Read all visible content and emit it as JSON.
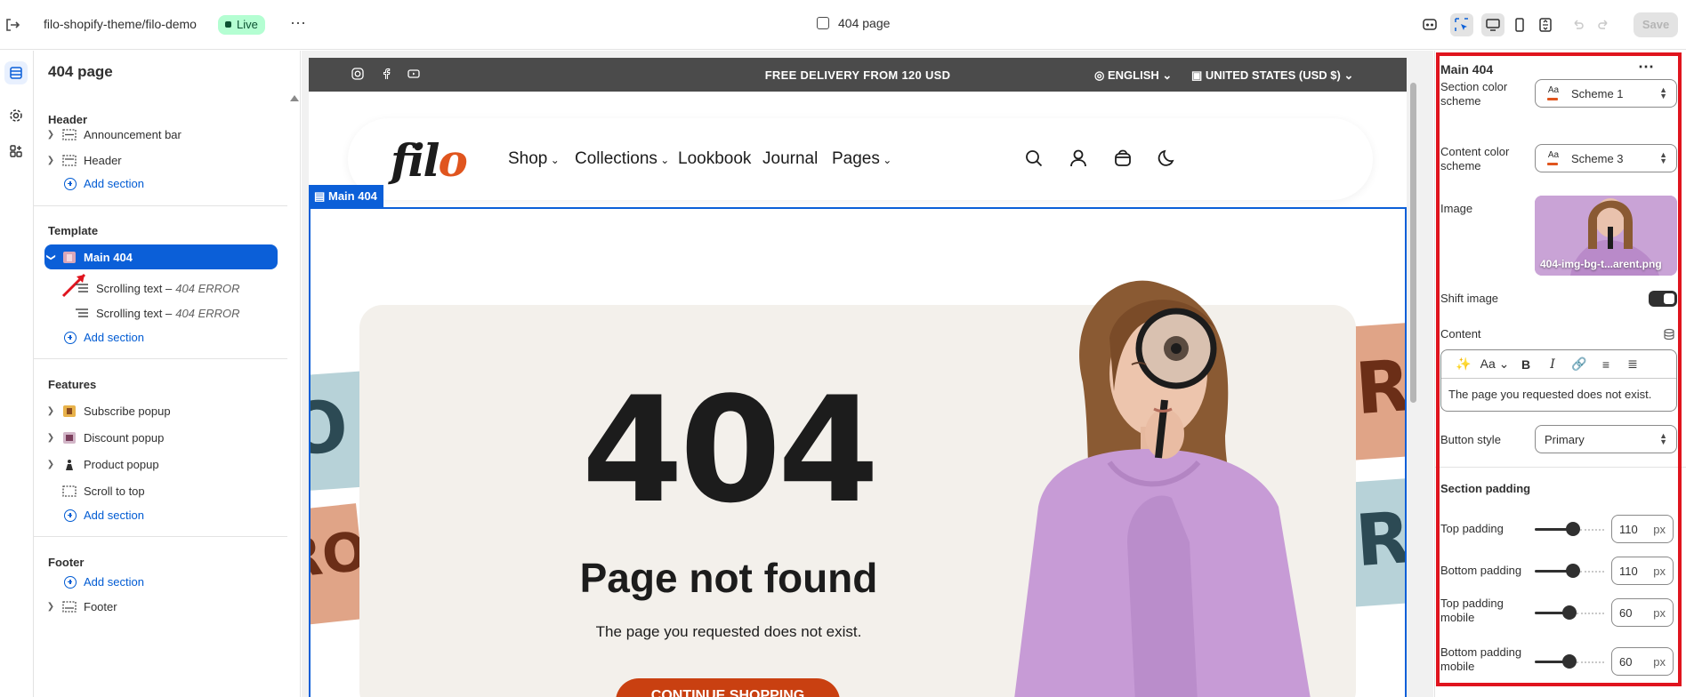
{
  "topbar": {
    "store_name": "filo-shopify-theme/filo-demo",
    "status": "Live",
    "more": "⋯",
    "page_title": "404 page",
    "save_label": "Save"
  },
  "sidebar": {
    "title": "404 page",
    "header_group": "Header",
    "header_items": [
      "Announcement bar",
      "Header"
    ],
    "template_group": "Template",
    "template_selected": "Main 404",
    "template_blocks": [
      {
        "label": "Scrolling text –",
        "sub": "404 ERROR"
      },
      {
        "label": "Scrolling text –",
        "sub": "404 ERROR"
      }
    ],
    "features_group": "Features",
    "features_items": [
      "Subscribe popup",
      "Discount popup",
      "Product popup",
      "Scroll to top"
    ],
    "footer_group": "Footer",
    "footer_items": [
      "Footer"
    ],
    "add_section": "Add section"
  },
  "preview": {
    "announcement": "FREE DELIVERY FROM 120 USD",
    "language": "ENGLISH",
    "currency": "UNITED STATES (USD $)",
    "logo_a": "fil",
    "logo_b": "o",
    "nav": [
      "Shop",
      "Collections",
      "Lookbook",
      "Journal",
      "Pages"
    ],
    "section_tag": "Main 404",
    "big": "404",
    "heading": "Page not found",
    "description": "The page you requested does not exist.",
    "cta": "CONTINUE SHOPPING",
    "banner_left_1": "O",
    "banner_left_2": "RO",
    "banner_right_1": "R",
    "banner_right_2": "R"
  },
  "settings": {
    "title": "Main 404",
    "section_color_scheme_label": "Section color scheme",
    "section_color_scheme": "Scheme 1",
    "content_color_scheme_label": "Content color scheme",
    "content_color_scheme": "Scheme 3",
    "image_label": "Image",
    "image_filename": "404-img-bg-t...arent.png",
    "shift_image_label": "Shift image",
    "shift_image": true,
    "content_label": "Content",
    "content_text": "The page you requested does not exist.",
    "button_style_label": "Button style",
    "button_style": "Primary",
    "section_padding_label": "Section padding",
    "paddings": [
      {
        "label": "Top padding",
        "value": "110",
        "unit": "px",
        "level": 0.55
      },
      {
        "label": "Bottom padding",
        "value": "110",
        "unit": "px",
        "level": 0.55
      },
      {
        "label": "Top padding mobile",
        "value": "60",
        "unit": "px",
        "level": 0.5
      },
      {
        "label": "Bottom padding mobile",
        "value": "60",
        "unit": "px",
        "level": 0.5
      }
    ]
  },
  "colors": {
    "accent_blue": "#0b5fd8",
    "brand_orange": "#c94011",
    "highlight_red": "#e0141e",
    "live_green": "#b4fed2"
  }
}
